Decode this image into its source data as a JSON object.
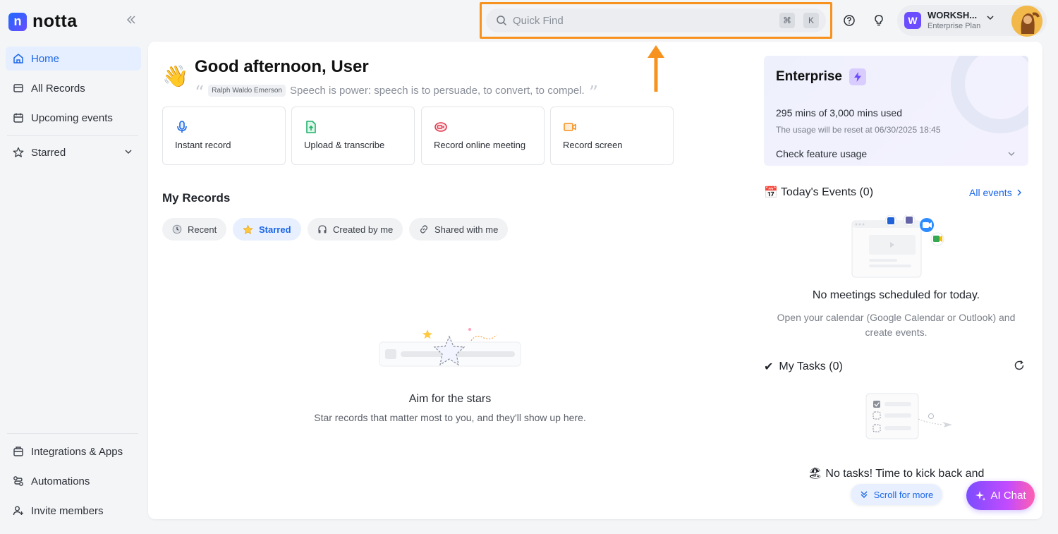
{
  "app": {
    "name": "notta",
    "logo_letter": "n"
  },
  "sidebar": {
    "items": [
      {
        "label": "Home",
        "icon": "home-icon",
        "active": true
      },
      {
        "label": "All Records",
        "icon": "folder-icon"
      },
      {
        "label": "Upcoming events",
        "icon": "calendar-icon"
      },
      {
        "label": "Starred",
        "icon": "star-icon",
        "expandable": true
      }
    ],
    "bottom_items": [
      {
        "label": "Integrations & Apps",
        "icon": "integrations-icon"
      },
      {
        "label": "Automations",
        "icon": "automation-icon"
      },
      {
        "label": "Invite members",
        "icon": "invite-icon"
      }
    ]
  },
  "topbar": {
    "search": {
      "placeholder": "Quick Find",
      "shortcut_mod": "⌘",
      "shortcut_key": "K"
    },
    "workspace": {
      "badge": "W",
      "name": "WORKSH...",
      "plan": "Enterprise Plan"
    }
  },
  "greeting": {
    "emoji": "👋",
    "title": "Good afternoon, User",
    "quote_author": "Ralph Waldo Emerson",
    "quote_text": "Speech is power: speech is to persuade, to convert, to compel."
  },
  "actions": [
    {
      "label": "Instant record",
      "icon": "microphone-icon",
      "color": "#1b66e8"
    },
    {
      "label": "Upload & transcribe",
      "icon": "upload-icon",
      "color": "#21b26b"
    },
    {
      "label": "Record online meeting",
      "icon": "meeting-icon",
      "color": "#e0394f"
    },
    {
      "label": "Record screen",
      "icon": "screen-record-icon",
      "color": "#f7921e"
    }
  ],
  "records": {
    "title": "My Records",
    "filters": [
      {
        "label": "Recent",
        "icon": "clock-icon"
      },
      {
        "label": "Starred",
        "icon": "star-icon",
        "active": true
      },
      {
        "label": "Created by me",
        "icon": "headphones-icon"
      },
      {
        "label": "Shared with me",
        "icon": "link-icon"
      }
    ],
    "empty_title": "Aim for the stars",
    "empty_subtitle": "Star records that matter most to you, and they'll show up here."
  },
  "enterprise": {
    "title": "Enterprise",
    "usage": "295 mins of 3,000 mins used",
    "reset": "The usage will be reset at 06/30/2025 18:45",
    "check": "Check feature usage"
  },
  "events": {
    "emoji": "📅",
    "title": "Today's Events (0)",
    "link": "All events",
    "empty_title": "No meetings scheduled for today.",
    "empty_subtitle": "Open your calendar (Google Calendar or Outlook) and create events."
  },
  "tasks": {
    "check": "✔",
    "title": "My Tasks (0)",
    "empty_emoji": "🏖",
    "empty_title": "No tasks! Time to kick back and"
  },
  "scroll_more": "Scroll for more",
  "ai_chat": "AI Chat",
  "colors": {
    "accent": "#1b66e8",
    "highlight": "#f7921e",
    "brand_purple": "#6b4dff"
  }
}
